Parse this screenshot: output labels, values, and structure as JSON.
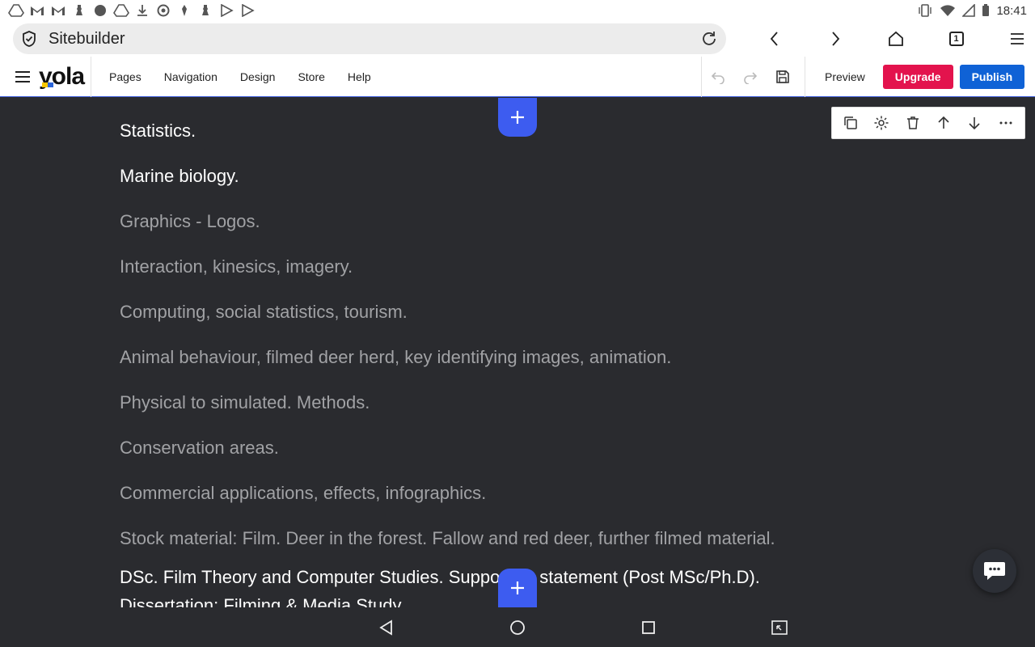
{
  "status_bar": {
    "time": "18:41",
    "left_icons": [
      "drive-icon",
      "gmail-icon",
      "gmail-icon",
      "chess-icon",
      "android-icon",
      "drive-icon",
      "download-icon",
      "aperture-icon",
      "pin-icon",
      "chess-icon",
      "play-icon",
      "play-icon"
    ],
    "right_icons": [
      "vibrate-icon",
      "wifi-icon",
      "signal-icon",
      "battery-icon"
    ]
  },
  "browser": {
    "url_title": "Sitebuilder",
    "tab_count": "1"
  },
  "app_header": {
    "logo": "yola",
    "menu": [
      "Pages",
      "Navigation",
      "Design",
      "Store",
      "Help"
    ],
    "preview_label": "Preview",
    "upgrade_label": "Upgrade",
    "publish_label": "Publish"
  },
  "content": {
    "lines": [
      {
        "text": "Statistics.",
        "style": "bright"
      },
      {
        "text": "Marine biology.",
        "style": "bright"
      },
      {
        "text": "Graphics - Logos.",
        "style": "dim"
      },
      {
        "text": "Interaction, kinesics, imagery.",
        "style": "dim"
      },
      {
        "text": "Computing, social statistics, tourism.",
        "style": "dim"
      },
      {
        "text": "Animal behaviour, filmed deer herd, key identifying images, animation.",
        "style": "dim"
      },
      {
        "text": "Physical to simulated. Methods.",
        "style": "dim"
      },
      {
        "text": "Conservation areas.",
        "style": "dim"
      },
      {
        "text": "Commercial applications, effects, infographics.",
        "style": "dim"
      },
      {
        "text": "Stock material: Film. Deer in the forest. Fallow and red deer, further filmed material.",
        "style": "dim"
      },
      {
        "text": "DSc.  Film Theory and Computer Studies. Supporting statement (Post MSc/Ph.D).",
        "style": "bright"
      },
      {
        "text": "Dissertation: Filming & Media Study.",
        "style": "bright"
      }
    ],
    "block_toolbar": [
      "duplicate-icon",
      "settings-icon",
      "delete-icon",
      "move-up-icon",
      "move-down-icon",
      "more-icon"
    ]
  },
  "colors": {
    "accent": "#3d5cf0",
    "upgrade": "#e3134d",
    "publish": "#0f62d6",
    "canvas": "#2a2b2f"
  }
}
